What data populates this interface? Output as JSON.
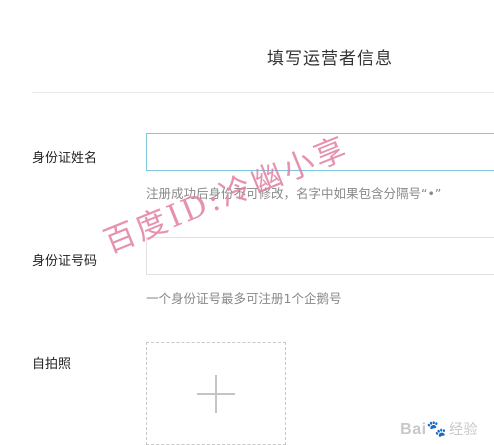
{
  "page": {
    "title": "填写运营者信息"
  },
  "form": {
    "id_name": {
      "label": "身份证姓名",
      "value": "",
      "hint": "注册成功后身份不可修改，名字中如果包含分隔号“•”"
    },
    "id_number": {
      "label": "身份证号码",
      "value": "",
      "hint": "一个身份证号最多可注册1个企鹅号"
    },
    "selfie": {
      "label": "自拍照"
    }
  },
  "watermark": {
    "text": "百度ID:冷幽小享"
  },
  "logo": {
    "brand": "Bai",
    "paw": "🐾",
    "suffix": "经验"
  },
  "colors": {
    "active_border": "#7fc6de",
    "watermark": "#e27fa0"
  }
}
